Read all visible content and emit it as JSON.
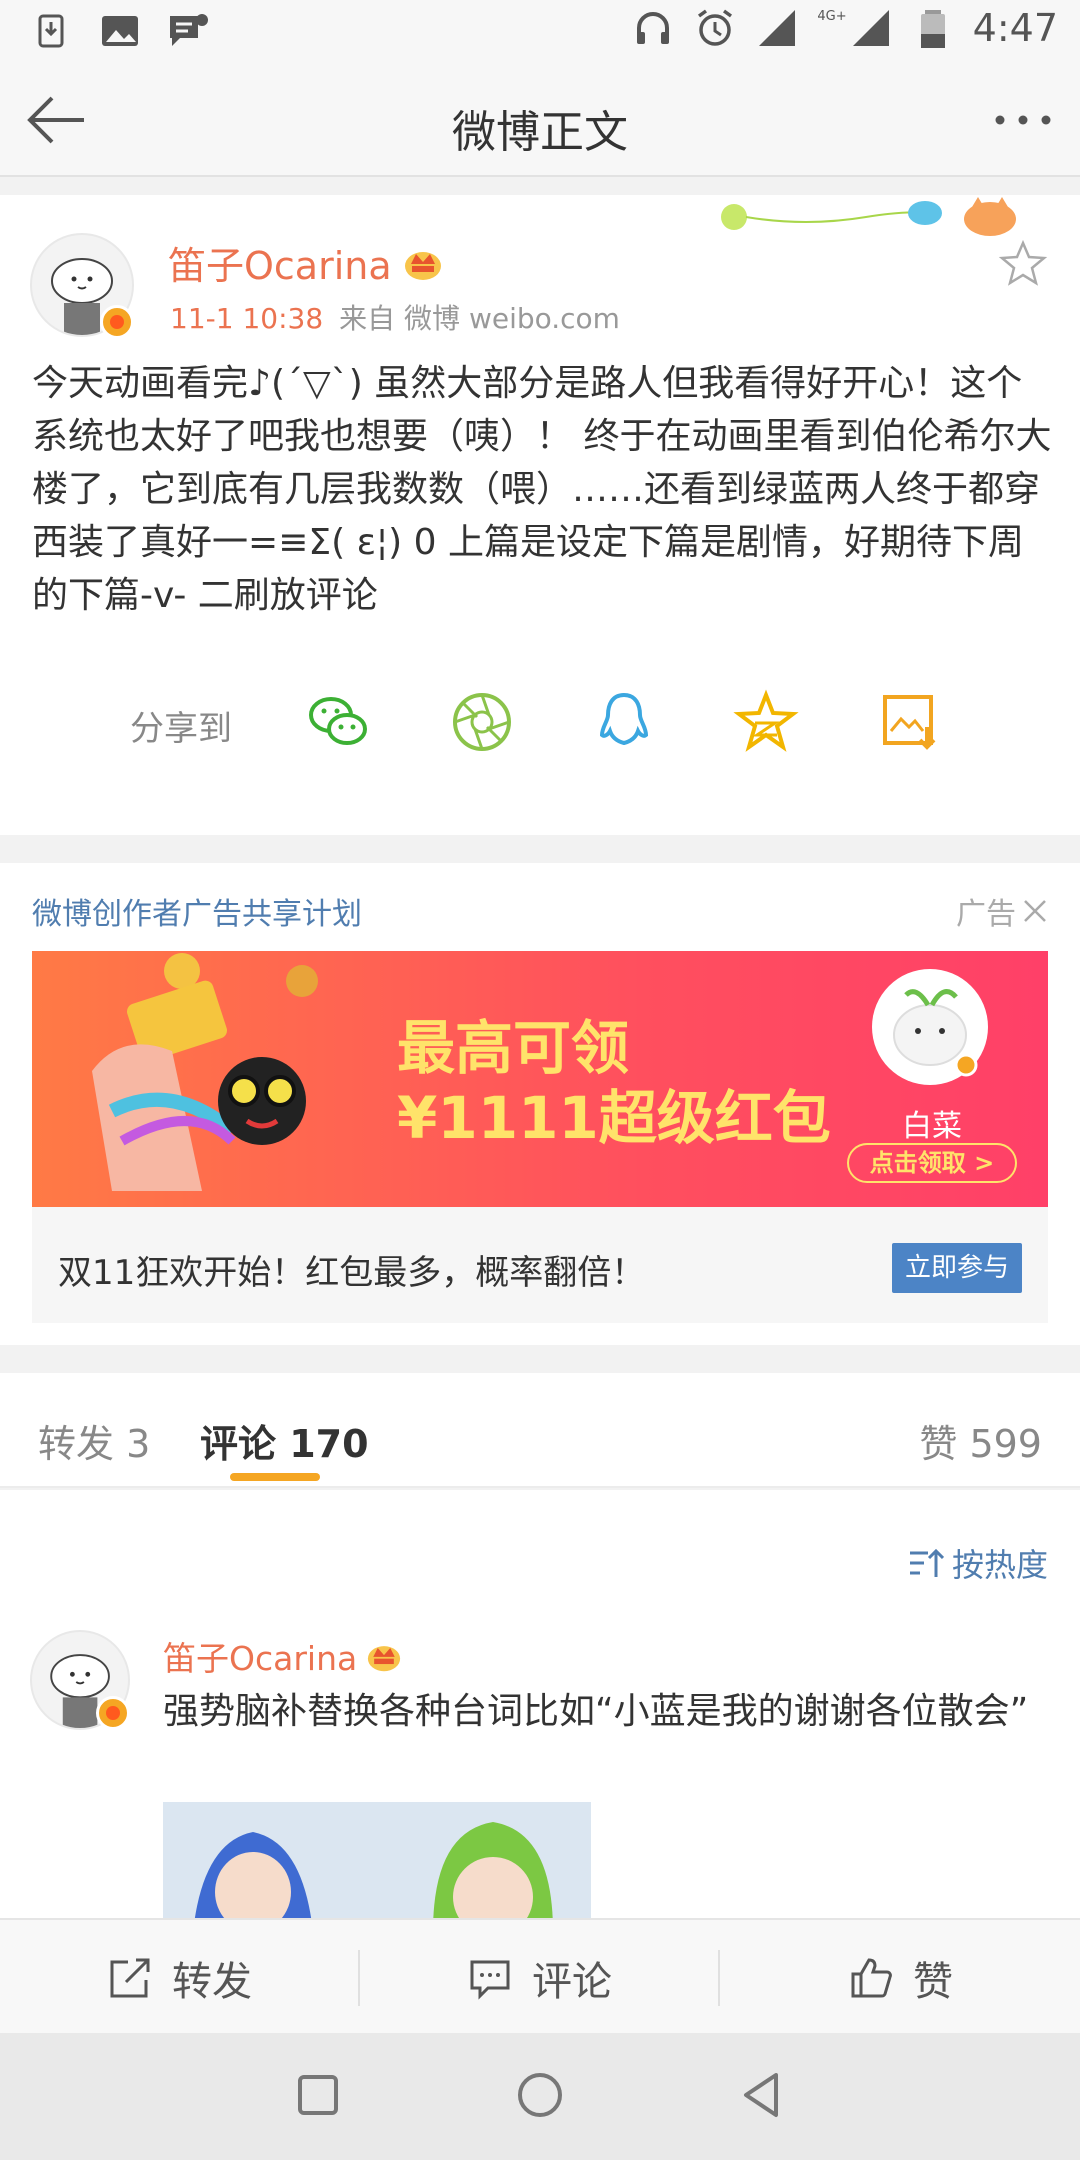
{
  "status_bar": {
    "time": "4:47",
    "network": "4G+"
  },
  "header": {
    "title": "微博正文"
  },
  "post": {
    "author": "笛子Ocarina",
    "time": "11-1 10:38",
    "source": "来自 微博 weibo.com",
    "text": "今天动画看完♪(´▽`) 虽然大部分是路人但我看得好开心！这个系统也太好了吧我也想要（咦）！ 终于在动画里看到伯伦希尔大楼了，它到底有几层我数数（喂）……还看到绿蓝两人终于都穿西装了真好一=≡Σ( ε¦) 0 上篇是设定下篇是剧情，好期待下周的下篇-v- 二刷放评论"
  },
  "share": {
    "label": "分享到",
    "targets": [
      "wechat-icon",
      "moments-icon",
      "qq-icon",
      "qzone-icon",
      "save-image-icon"
    ]
  },
  "ad": {
    "title": "微博创作者广告共享计划",
    "tag": "广告",
    "headline_line1": "最高可领",
    "headline_line2": "¥1111超级红包",
    "brand": "白菜",
    "banner_cta": "点击领取 >",
    "footer_text": "双11狂欢开始！红包最多，概率翻倍！",
    "join_label": "立即参与"
  },
  "tabs": {
    "repost": "转发 3",
    "comments": "评论 170",
    "likes": "赞 599"
  },
  "comments": {
    "sort_label": "按热度",
    "items": [
      {
        "author": "笛子Ocarina",
        "text": "强势脑补替换各种台词比如“小蓝是我的谢谢各位散会”"
      }
    ]
  },
  "actions": {
    "repost": "转发",
    "comment": "评论",
    "like": "赞"
  },
  "colors": {
    "accent_orange": "#eb7350",
    "link_blue": "#507daf",
    "tab_underline": "#f5a623",
    "ad_button": "#4c84c6"
  }
}
